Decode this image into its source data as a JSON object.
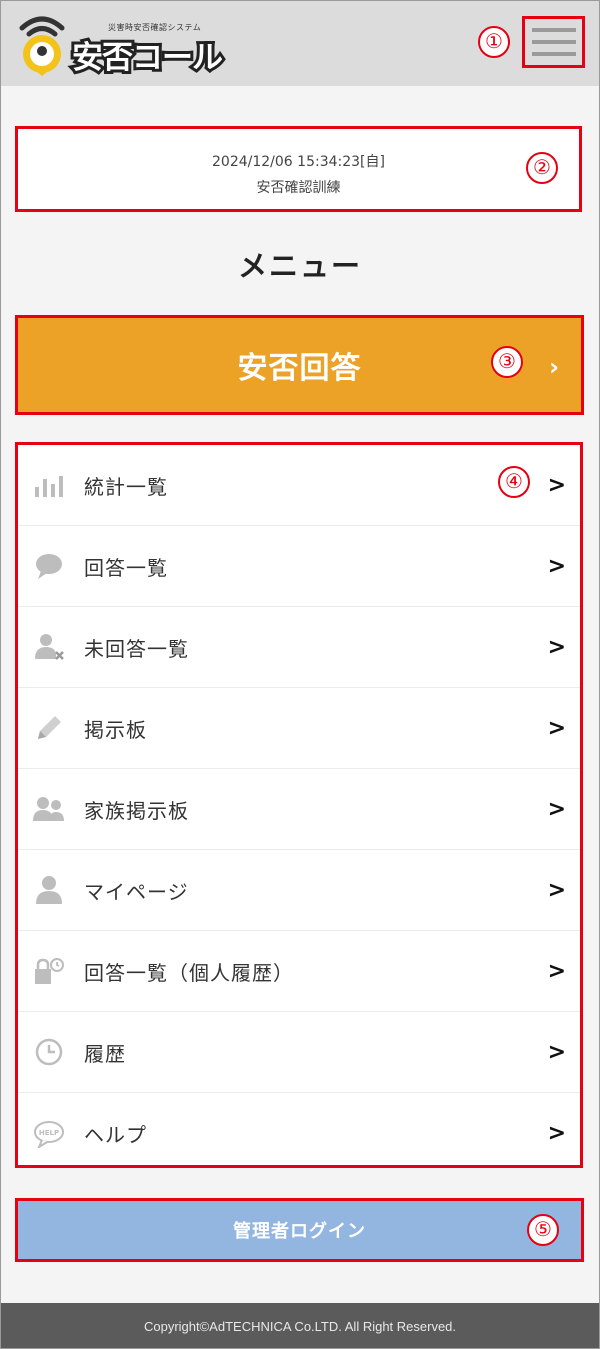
{
  "header": {
    "logo_tagline": "災害時安否確認システム",
    "logo_text": "安否コール",
    "menu_icon": "hamburger-icon"
  },
  "notice": {
    "datetime": "2024/12/06 15:34:23[自]",
    "label": "安否確認訓練"
  },
  "menu_title": "メニュー",
  "primary_action": {
    "label": "安否回答"
  },
  "menu": {
    "items": [
      {
        "label": "統計一覧",
        "icon": "bar-chart-icon"
      },
      {
        "label": "回答一覧",
        "icon": "speech-bubble-icon"
      },
      {
        "label": "未回答一覧",
        "icon": "user-cross-icon"
      },
      {
        "label": "掲示板",
        "icon": "pencil-icon"
      },
      {
        "label": "家族掲示板",
        "icon": "family-icon"
      },
      {
        "label": "マイページ",
        "icon": "user-icon"
      },
      {
        "label": "回答一覧（個人履歴）",
        "icon": "lock-history-icon"
      },
      {
        "label": "履歴",
        "icon": "clock-icon"
      },
      {
        "label": "ヘルプ",
        "icon": "help-bubble-icon"
      }
    ]
  },
  "admin_login": {
    "label": "管理者ログイン"
  },
  "footer": {
    "copyright": "Copyright©AdTECHNICA Co.LTD. All Right Reserved."
  },
  "callouts": [
    "①",
    "②",
    "③",
    "④",
    "⑤"
  ],
  "colors": {
    "accent_red": "#e60012",
    "primary_orange": "#eca227",
    "admin_blue": "#93b6e0",
    "header_gray": "#dcdcdc",
    "footer_gray": "#5b5b5b"
  }
}
